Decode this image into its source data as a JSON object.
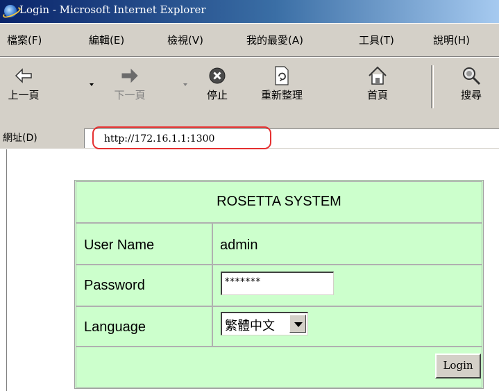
{
  "window": {
    "title": "Login - Microsoft Internet Explorer"
  },
  "menu": [
    {
      "label": "檔案(F)"
    },
    {
      "label": "編輯(E)"
    },
    {
      "label": "檢視(V)"
    },
    {
      "label": "我的最愛(A)"
    },
    {
      "label": "工具(T)"
    },
    {
      "label": "說明(H)"
    }
  ],
  "toolbar": {
    "back": "上一頁",
    "forward": "下一頁",
    "stop": "停止",
    "refresh": "重新整理",
    "home": "首頁",
    "search": "搜尋"
  },
  "address": {
    "label": "網址(D)",
    "value": "http://172.16.1.1:1300"
  },
  "login": {
    "header": "ROSETTA SYSTEM",
    "username_label": "User Name",
    "username_value": "admin",
    "password_label": "Password",
    "password_value": "*******",
    "language_label": "Language",
    "language_value": "繁體中文",
    "submit_label": "Login"
  },
  "colors": {
    "form_background": "#ccffcc",
    "highlight": "#e53030"
  },
  "icons": [
    "ie-icon",
    "back-arrow-icon",
    "forward-arrow-icon",
    "stop-icon",
    "refresh-icon",
    "home-icon",
    "search-icon",
    "dropdown-arrow-icon"
  ]
}
